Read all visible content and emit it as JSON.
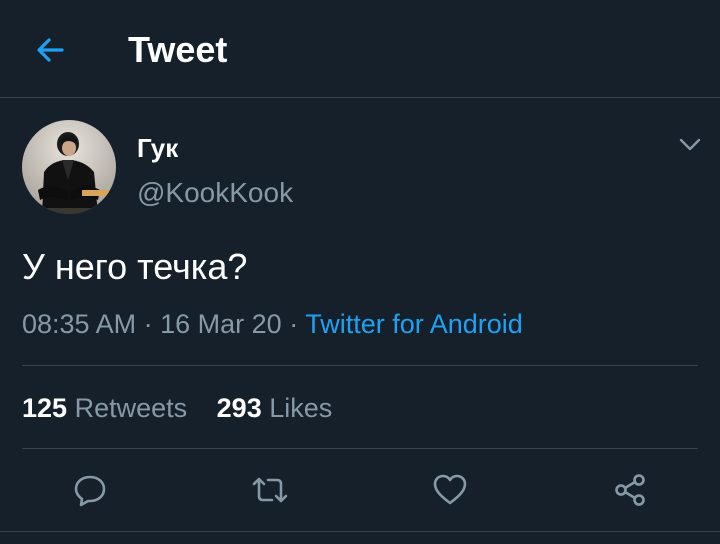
{
  "header": {
    "title": "Tweet",
    "back_icon": "arrow-left-icon"
  },
  "colors": {
    "background": "#15202b",
    "accent": "#1da1f2",
    "secondary_text": "#8899a6",
    "divider": "#38444d"
  },
  "tweet": {
    "author": {
      "display_name": "Гук",
      "handle": "@KookKook"
    },
    "text": "У него течка?",
    "time": "08:35 AM",
    "date": "16 Mar 20",
    "separator": "·",
    "source": "Twitter for Android"
  },
  "stats": {
    "retweets_count": "125",
    "retweets_label": "Retweets",
    "likes_count": "293",
    "likes_label": "Likes"
  },
  "actions": [
    {
      "icon": "reply-icon"
    },
    {
      "icon": "retweet-icon"
    },
    {
      "icon": "heart-icon"
    },
    {
      "icon": "share-icon"
    }
  ]
}
